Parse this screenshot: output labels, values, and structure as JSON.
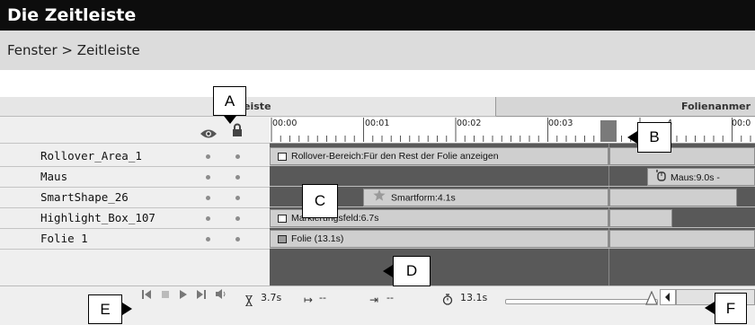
{
  "header": {
    "title": "Die Zeitleiste",
    "path": "Fenster > Zeitleiste"
  },
  "tabs": {
    "timeline": "tleiste",
    "notes": "Folienanmer"
  },
  "ruler": {
    "labels": [
      "00:00",
      "00:01",
      "00:02",
      "00:03",
      "4",
      "00:0"
    ]
  },
  "layers": [
    {
      "name": "Rollover_Area_1",
      "object_label": "Rollover-Bereich:Für den Rest der Folie anzeigen"
    },
    {
      "name": "Maus",
      "object_label": "Maus:9.0s -"
    },
    {
      "name": "SmartShape_26",
      "object_label": "Smartform:4.1s"
    },
    {
      "name": "Highlight_Box_107",
      "object_label": "Markierungsfeld:6.7s"
    },
    {
      "name": "Folie 1",
      "object_label": "Folie (13.1s)"
    }
  ],
  "status": {
    "duration": "3.7s",
    "start": "--",
    "end": "--",
    "total": "13.1s"
  },
  "callouts": {
    "a": "A",
    "b": "B",
    "c": "C",
    "d": "D",
    "e": "E",
    "f": "F"
  },
  "icons": [
    "eye-icon",
    "lock-icon",
    "rewind-icon",
    "stop-icon",
    "play-icon",
    "forward-icon",
    "speaker-icon",
    "hourglass-icon",
    "start-time-icon",
    "end-time-icon",
    "timer-icon",
    "mouse-icon",
    "star-icon"
  ]
}
